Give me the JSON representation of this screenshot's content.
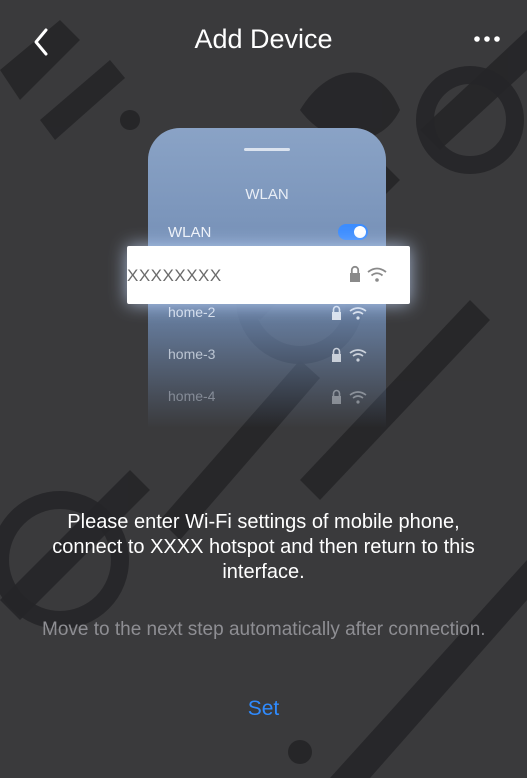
{
  "header": {
    "title": "Add Device",
    "back_icon": "chevron-left-icon",
    "more_icon": "more-horizontal-icon"
  },
  "phone": {
    "screen_title": "WLAN",
    "wlan_label": "WLAN",
    "wlan_enabled": true,
    "selected_network": "XXXXXXXX",
    "networks": [
      "home-2",
      "home-3",
      "home-4"
    ]
  },
  "instruction": "Please enter Wi-Fi settings of mobile phone, connect to XXXX hotspot and then return to this interface.",
  "hint": "Move to the next step automatically after connection.",
  "set_label": "Set",
  "colors": {
    "background": "#3a3a3c",
    "accent": "#2f8bff",
    "hint": "#8e8e93"
  }
}
